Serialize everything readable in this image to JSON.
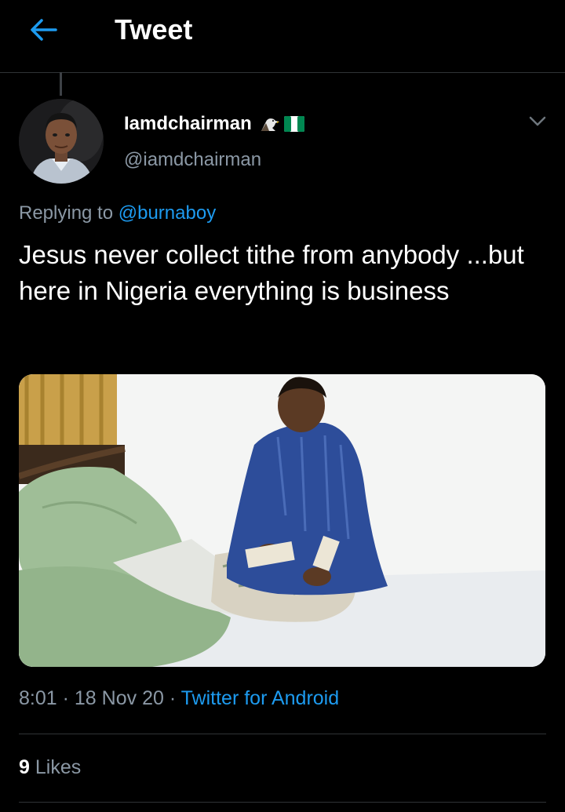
{
  "header": {
    "title": "Tweet",
    "back_icon": "arrow-left-icon",
    "accent_color": "#1d9bf0"
  },
  "author": {
    "display_name": "Iamdchairman",
    "handle": "@iamdchairman",
    "name_emojis": [
      "eagle-icon",
      "nigeria-flag-icon"
    ],
    "menu_icon": "chevron-down-icon"
  },
  "reply": {
    "prefix": "Replying to",
    "mention": "@burnaboy"
  },
  "tweet": {
    "text": "Jesus never collect tithe from anybody ...but here in Nigeria everything is business",
    "time": "8:01",
    "date": "18 Nov 20",
    "source": "Twitter for Android"
  },
  "stats": {
    "likes_count": "9",
    "likes_label": "Likes"
  },
  "colors": {
    "background": "#000000",
    "secondary_text": "#8b98a5",
    "divider": "#2f3336",
    "link": "#1d9bf0"
  }
}
